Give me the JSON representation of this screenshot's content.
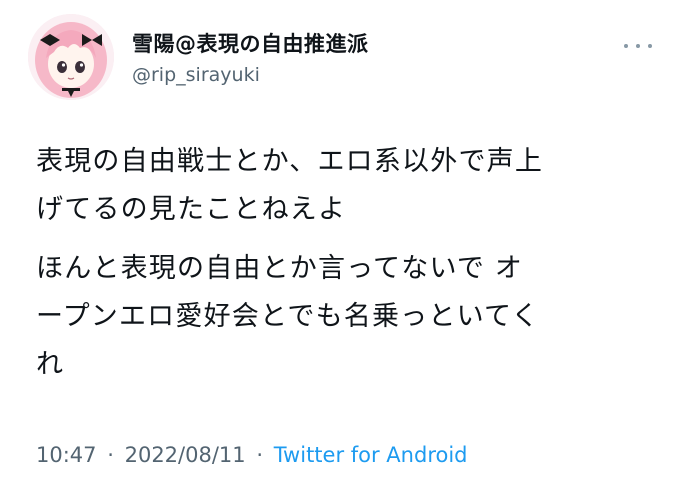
{
  "tweet": {
    "display_name": "雪陽@表現の自由推進派",
    "handle": "@rip_sirayuki",
    "more_icon": "more-dots-icon",
    "avatar_icon": "anime-girl-avatar",
    "paragraphs": [
      "表現の自由戦士とか、エロ系以外で声上\nげてるの見たことねえよ",
      "ほんと表現の自由とか言ってないで オ\nープンエロ愛好会とでも名乗っといてく\nれ"
    ],
    "time": "10:47",
    "date": "2022/08/11",
    "separator": "·",
    "source": "Twitter for Android"
  },
  "colors": {
    "text": "#0f1419",
    "secondary": "#536471",
    "link": "#1d9bf0",
    "avatar_hair": "#f6b8c8"
  }
}
